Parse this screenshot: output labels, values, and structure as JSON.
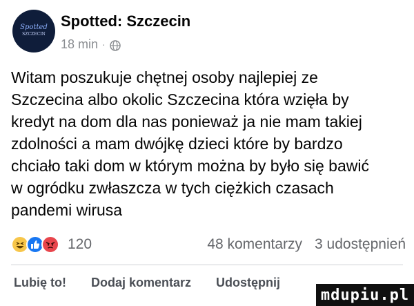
{
  "post": {
    "page_name": "Spotted: Szczecin",
    "time": "18 min",
    "separator": "·",
    "avatar_text": "Spotted",
    "avatar_subtext": "SZCZECIN",
    "privacy_icon": "globe-icon",
    "body": "Witam poszukuje chętnej osoby najlepiej ze\nSzczecina albo okolic Szczecina która wzięła by\nkredyt na dom dla nas ponieważ ja nie mam takiej\nzdolności a mam dwójkę dzieci które by bardzo\nchciało taki dom w którym można by było się bawić\nw ogródku zwłaszcza w tych ciężkich czasach\npandemi wirusa"
  },
  "stats": {
    "reaction_icons": [
      "haha-icon",
      "like-icon",
      "angry-icon"
    ],
    "reaction_count": "120",
    "comments": "48 komentarzy",
    "shares": "3 udostępnień"
  },
  "actions": {
    "like": "Lubię to!",
    "comment": "Dodaj komentarz",
    "share": "Udostępnij"
  },
  "watermark": "mdupiu.pl",
  "colors": {
    "like_blue": "#1877f2",
    "haha_yellow": "#f7c64a",
    "angry_red": "#e8454c",
    "meta_gray": "#8a8d91"
  }
}
